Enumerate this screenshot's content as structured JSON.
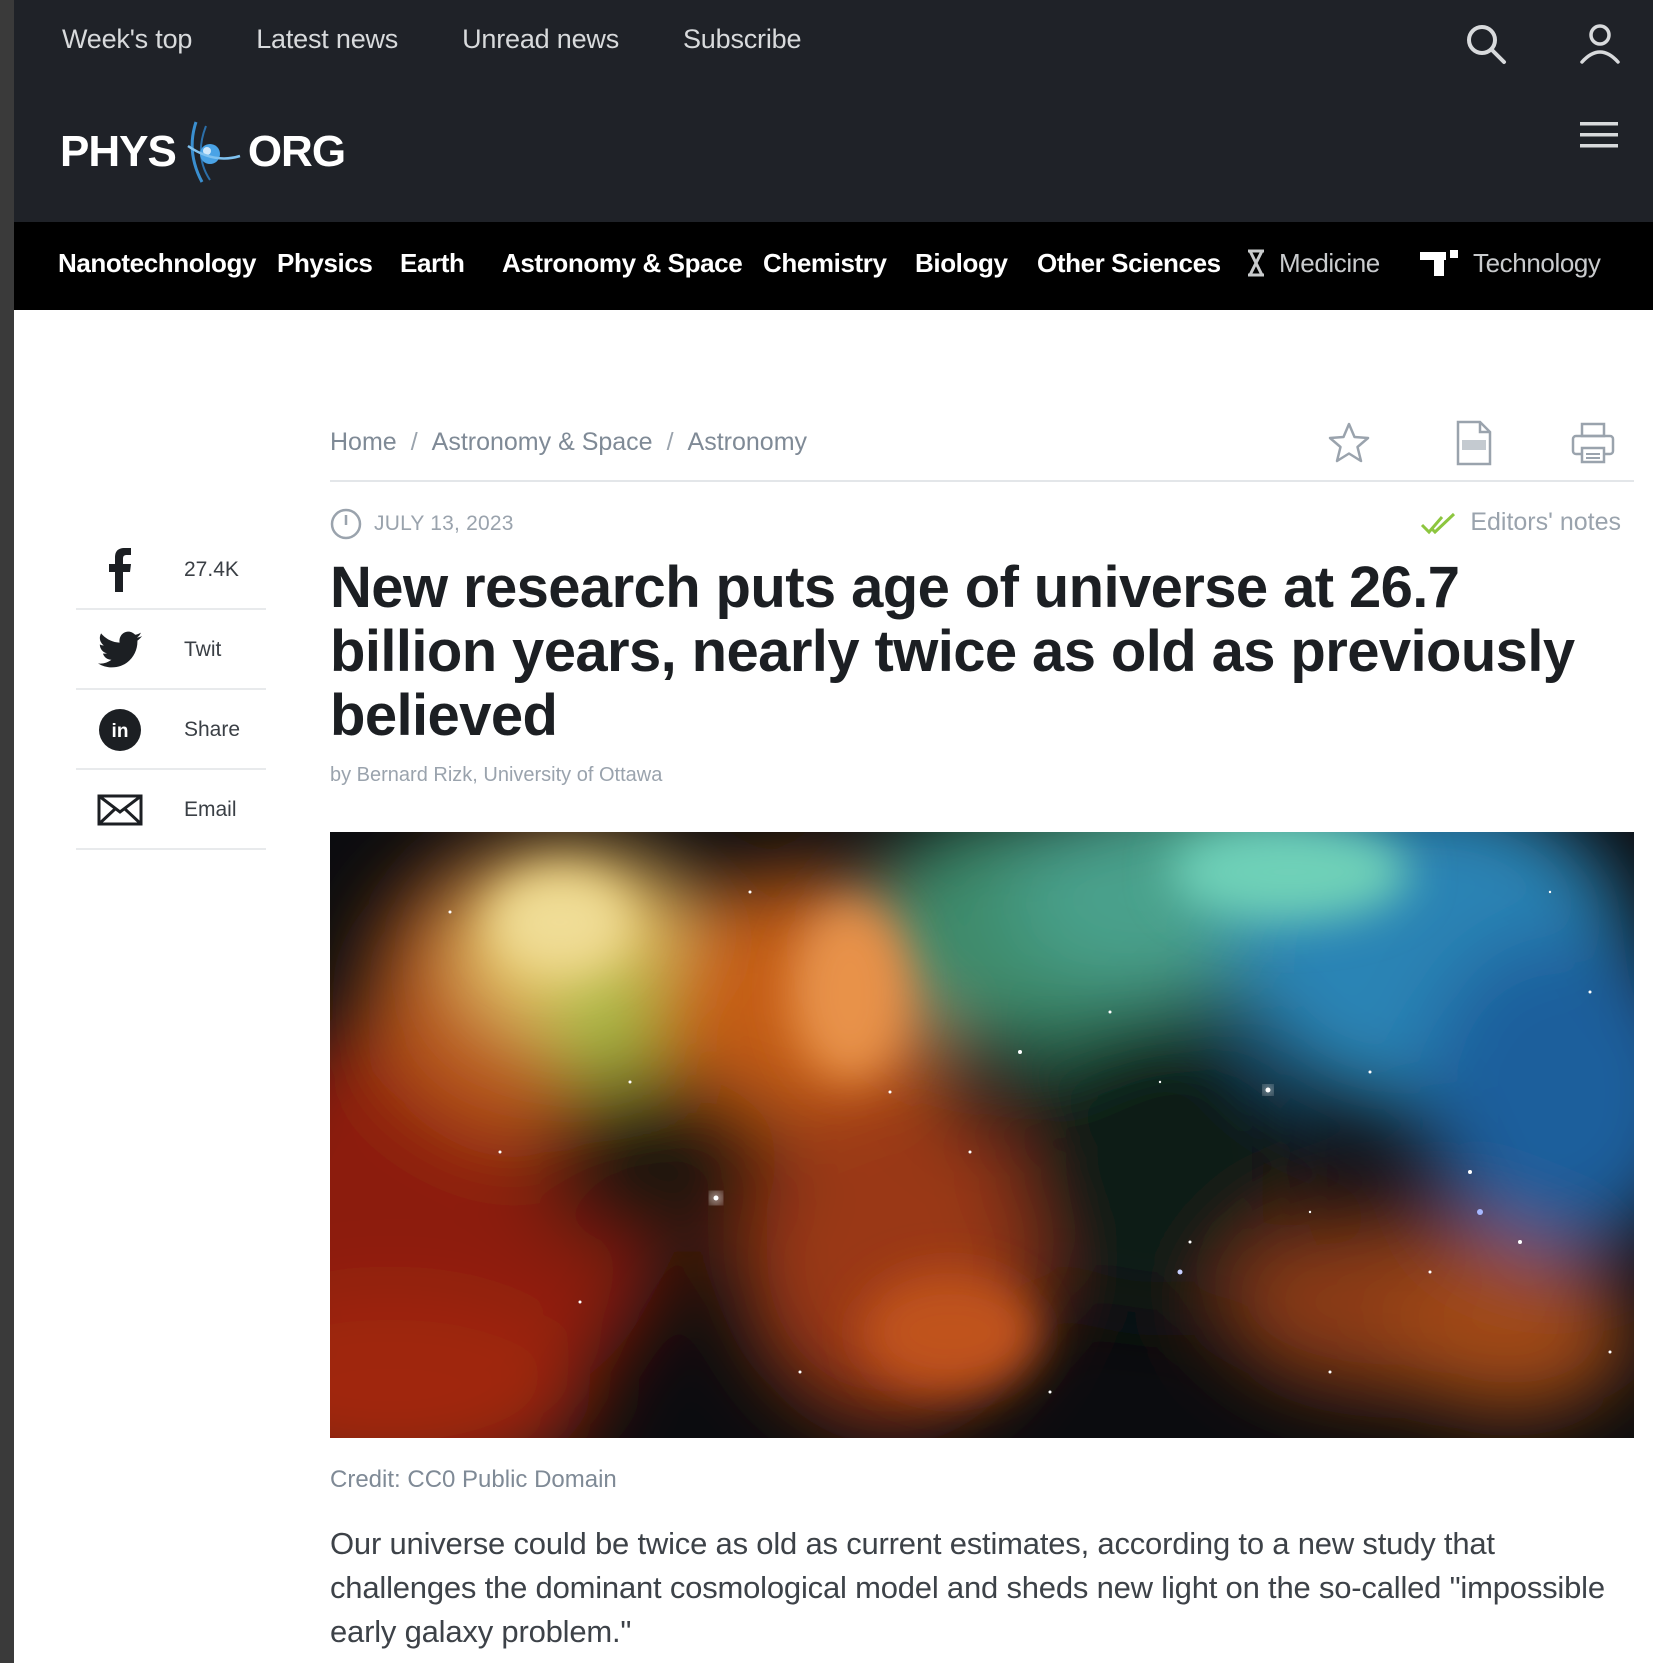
{
  "top_nav": {
    "items": [
      "Week's top",
      "Latest news",
      "Unread news",
      "Subscribe"
    ]
  },
  "logo": {
    "left_word": "PHYS",
    "right_word": "ORG"
  },
  "categories": [
    {
      "label": "Nanotechnology",
      "dim": false
    },
    {
      "label": "Physics",
      "dim": false
    },
    {
      "label": "Earth",
      "dim": false
    },
    {
      "label": "Astronomy & Space",
      "dim": false
    },
    {
      "label": "Chemistry",
      "dim": false
    },
    {
      "label": "Biology",
      "dim": false
    },
    {
      "label": "Other Sciences",
      "dim": false
    },
    {
      "label": "Medicine",
      "dim": true,
      "icon": "medicine-hourglass-icon"
    },
    {
      "label": "Technology",
      "dim": true,
      "icon": "technology-block-icon"
    }
  ],
  "breadcrumb": {
    "items": [
      "Home",
      "Astronomy & Space",
      "Astronomy"
    ],
    "separator": "/"
  },
  "tools": [
    "bookmark-star-icon",
    "pdf-icon",
    "print-icon"
  ],
  "article": {
    "date": "JULY 13, 2023",
    "editors_notes": "Editors' notes",
    "title": "New research puts age of universe at 26.7 billion years, nearly twice as old as previously believed",
    "byline": "by Bernard Rizk, University of Ottawa",
    "image_credit": "Credit: CC0 Public Domain",
    "lead": "Our universe could be twice as old as current estimates, according to a new study that challenges the dominant cosmological model and sheds new light on the so-called \"impossible early galaxy problem.\""
  },
  "share": [
    {
      "icon": "facebook-icon",
      "label": "27.4K"
    },
    {
      "icon": "twitter-icon",
      "label": "Twit"
    },
    {
      "icon": "linkedin-icon",
      "label": "Share"
    },
    {
      "icon": "email-icon",
      "label": "Email"
    }
  ],
  "colors": {
    "header_bg": "#1f2228",
    "category_bar_bg": "#000000",
    "title_text": "#1c1f23",
    "muted_text": "#9aa3ad",
    "editors_check": "#8dc63f"
  }
}
